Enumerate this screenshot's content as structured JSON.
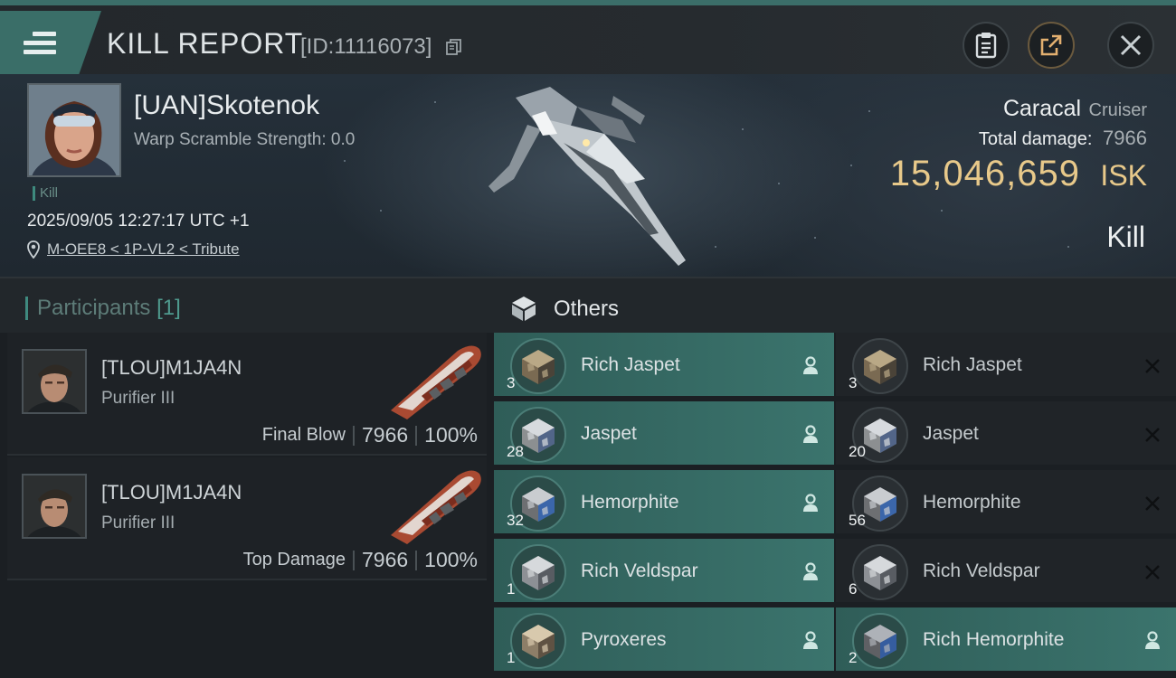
{
  "header": {
    "title": "KILL REPORT",
    "report_id": "[ID:11116073]",
    "icons": [
      "menu-icon",
      "copy-icon",
      "clipboard-icon",
      "share-icon",
      "close-icon"
    ]
  },
  "victim": {
    "name": "[UAN]Skotenok",
    "warp_scramble": "Warp Scramble Strength: 0.0",
    "tag": "Kill",
    "datetime": "2025/09/05 12:27:17 UTC +1",
    "location": "M-OEE8 < 1P-VL2 < Tribute",
    "ship_name": "Caracal",
    "ship_class": "Cruiser",
    "total_damage_label": "Total damage:",
    "total_damage": "7966",
    "isk_value": "15,046,659",
    "isk_unit": "ISK",
    "outcome": "Kill"
  },
  "participants": {
    "title": "Participants",
    "count": "[1]",
    "rows": [
      {
        "name": "[TLOU]M1JA4N",
        "ship": "Purifier III",
        "role": "Final Blow",
        "damage": "7966",
        "percent": "100%"
      },
      {
        "name": "[TLOU]M1JA4N",
        "ship": "Purifier III",
        "role": "Top Damage",
        "damage": "7966",
        "percent": "100%"
      }
    ]
  },
  "others": {
    "title": "Others",
    "colors": {
      "dropped": "#3b746d",
      "destroyed": "#202428"
    },
    "left": [
      {
        "qty": "3",
        "name": "Rich Jaspet",
        "status": "dropped"
      },
      {
        "qty": "28",
        "name": "Jaspet",
        "status": "dropped"
      },
      {
        "qty": "32",
        "name": "Hemorphite",
        "status": "dropped"
      },
      {
        "qty": "1",
        "name": "Rich Veldspar",
        "status": "dropped"
      },
      {
        "qty": "1",
        "name": "Pyroxeres",
        "status": "dropped"
      }
    ],
    "right": [
      {
        "qty": "3",
        "name": "Rich Jaspet",
        "status": "destroyed"
      },
      {
        "qty": "20",
        "name": "Jaspet",
        "status": "destroyed"
      },
      {
        "qty": "56",
        "name": "Hemorphite",
        "status": "destroyed"
      },
      {
        "qty": "6",
        "name": "Rich Veldspar",
        "status": "destroyed"
      },
      {
        "qty": "2",
        "name": "Rich Hemorphite",
        "status": "dropped"
      }
    ]
  }
}
